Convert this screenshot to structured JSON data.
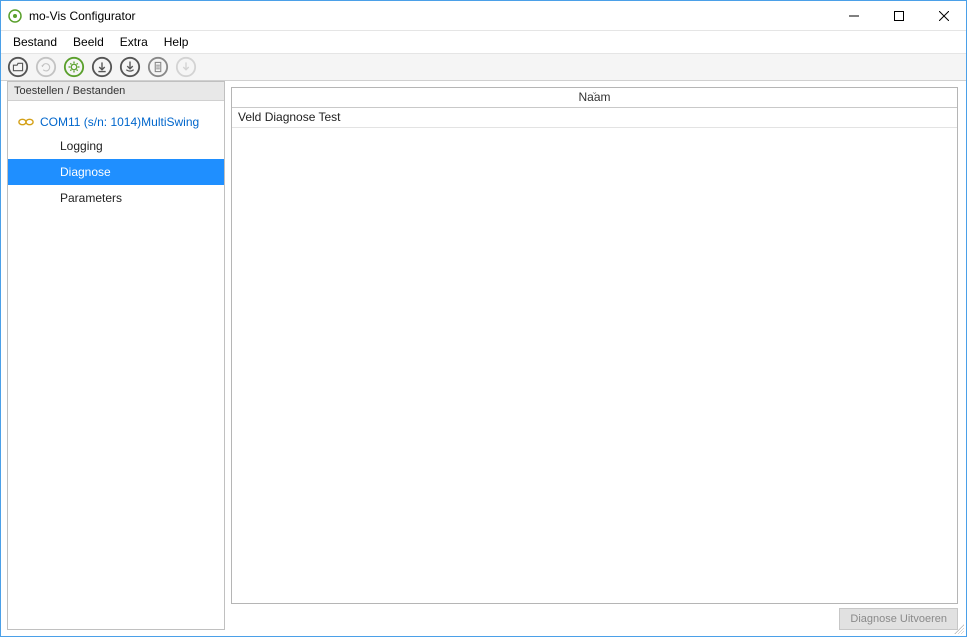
{
  "title": "mo-Vis Configurator",
  "menus": [
    "Bestand",
    "Beeld",
    "Extra",
    "Help"
  ],
  "toolbar_icons": [
    {
      "name": "open-folder-icon",
      "enabled": true,
      "color": "#555"
    },
    {
      "name": "refresh-icon",
      "enabled": false,
      "color": "#888"
    },
    {
      "name": "gear-icon",
      "enabled": true,
      "color": "#5aa02c"
    },
    {
      "name": "download-device-icon",
      "enabled": true,
      "color": "#555"
    },
    {
      "name": "download-all-icon",
      "enabled": true,
      "color": "#555"
    },
    {
      "name": "document-icon",
      "enabled": true,
      "color": "#888"
    },
    {
      "name": "download-disabled-icon",
      "enabled": false,
      "color": "#888"
    }
  ],
  "left": {
    "header": "Toestellen / Bestanden",
    "device": "COM11 (s/n: 1014)MultiSwing",
    "children": [
      {
        "label": "Logging",
        "selected": false
      },
      {
        "label": "Diagnose",
        "selected": true
      },
      {
        "label": "Parameters",
        "selected": false
      }
    ]
  },
  "grid": {
    "header": "Naam",
    "rows": [
      "Veld Diagnose Test"
    ]
  },
  "exec_button": "Diagnose Uitvoeren",
  "colors": {
    "selection": "#1f8fff",
    "link": "#0066cc",
    "accent": "#5aa02c"
  }
}
